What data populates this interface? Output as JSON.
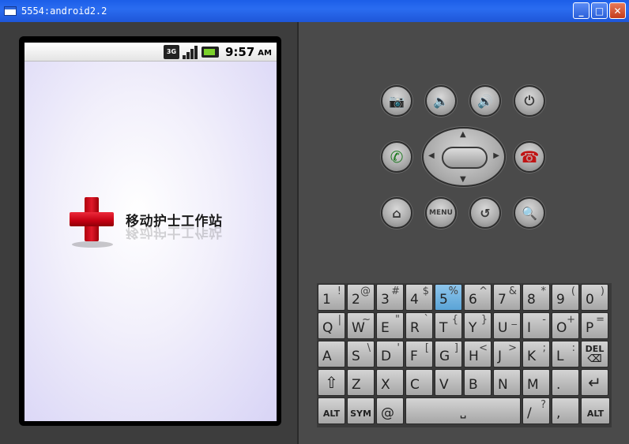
{
  "window": {
    "title": "5554:android2.2",
    "minimize": "_",
    "maximize": "□",
    "close": "✕"
  },
  "statusbar": {
    "network": "3G",
    "time": "9:57",
    "ampm": "AM"
  },
  "app": {
    "title": "移动护士工作站"
  },
  "hardware": {
    "menu_label": "MENU"
  },
  "keyboard": {
    "rows": [
      [
        {
          "m": "1",
          "s": "!"
        },
        {
          "m": "2",
          "s": "@"
        },
        {
          "m": "3",
          "s": "#"
        },
        {
          "m": "4",
          "s": "$"
        },
        {
          "m": "5",
          "s": "%"
        },
        {
          "m": "6",
          "s": "^"
        },
        {
          "m": "7",
          "s": "&"
        },
        {
          "m": "8",
          "s": "*"
        },
        {
          "m": "9",
          "s": "("
        },
        {
          "m": "0",
          "s": ")"
        }
      ],
      [
        {
          "m": "Q",
          "s": "|"
        },
        {
          "m": "W",
          "s": "~"
        },
        {
          "m": "E",
          "s": "\""
        },
        {
          "m": "R",
          "s": "`"
        },
        {
          "m": "T",
          "s": "{"
        },
        {
          "m": "Y",
          "s": "}"
        },
        {
          "m": "U",
          "s": "_"
        },
        {
          "m": "I",
          "s": "-"
        },
        {
          "m": "O",
          "s": "+"
        },
        {
          "m": "P",
          "s": "="
        }
      ],
      [
        {
          "m": "A",
          "s": ""
        },
        {
          "m": "S",
          "s": "\\"
        },
        {
          "m": "D",
          "s": "'"
        },
        {
          "m": "F",
          "s": "["
        },
        {
          "m": "G",
          "s": "]"
        },
        {
          "m": "H",
          "s": "<"
        },
        {
          "m": "J",
          "s": ">"
        },
        {
          "m": "K",
          "s": ";"
        },
        {
          "m": "L",
          "s": ":"
        },
        {
          "m": "",
          "s": "DEL"
        }
      ],
      [
        {
          "m": "⇧",
          "s": ""
        },
        {
          "m": "Z",
          "s": ""
        },
        {
          "m": "X",
          "s": ""
        },
        {
          "m": "C",
          "s": ""
        },
        {
          "m": "V",
          "s": ""
        },
        {
          "m": "B",
          "s": ""
        },
        {
          "m": "N",
          "s": ""
        },
        {
          "m": "M",
          "s": ""
        },
        {
          "m": ".",
          "s": ""
        },
        {
          "m": "↵",
          "s": ""
        }
      ]
    ],
    "bottom": {
      "alt_left": "ALT",
      "sym": "SYM",
      "at": "@",
      "space": "␣",
      "slash_m": "/",
      "slash_s": "?",
      "comma": ",",
      "alt_right": "ALT"
    },
    "highlighted_key": "5"
  }
}
